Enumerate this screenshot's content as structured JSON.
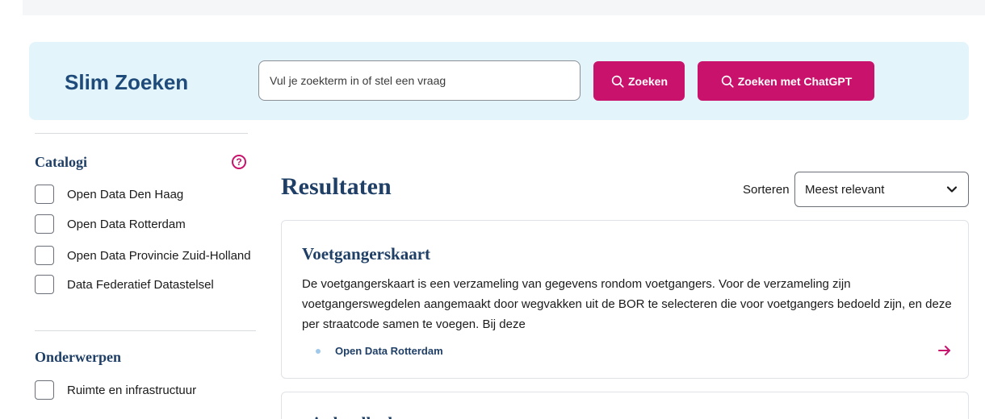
{
  "brand": {
    "title": "Slim Zoeken"
  },
  "search": {
    "placeholder": "Vul je zoekterm in of stel een vraag",
    "value": "",
    "search_button": "Zoeken",
    "chatgpt_button": "Zoeken met ChatGPT"
  },
  "facets": {
    "catalogi": {
      "title": "Catalogi",
      "help": "?",
      "items": [
        {
          "label": "Open Data Den Haag",
          "checked": false
        },
        {
          "label": "Open Data Rotterdam",
          "checked": false
        },
        {
          "label": "Open Data Provincie Zuid-Holland",
          "checked": false
        },
        {
          "label": "Data Federatief Datastelsel",
          "checked": false
        }
      ]
    },
    "onderwerpen": {
      "title": "Onderwerpen",
      "items": [
        {
          "label": "Ruimte en infrastructuur",
          "checked": false
        }
      ]
    }
  },
  "results": {
    "title": "Resultaten",
    "sort_label": "Sorteren",
    "sort_value": "Meest relevant",
    "items": [
      {
        "title": "Voetgangerskaart",
        "description": "De voetgangerskaart is een verzameling van gegevens rondom voetgangers. Voor de verzameling zijn voetgangerswegdelen aangemaakt door wegvakken uit de BOR te selecteren die voor voetgangers bedoeld zijn, en deze per straatcode samen te voegen. Bij deze",
        "catalog": "Open Data Rotterdam"
      },
      {
        "title": "windsnelheden"
      }
    ]
  },
  "colors": {
    "accent": "#c8126b",
    "brand": "#1f4b7a",
    "banner": "#e3f4fb"
  },
  "icons": {
    "search": "search-icon",
    "help": "help-icon",
    "chevron": "chevron-down-icon",
    "arrow": "arrow-right-icon"
  }
}
